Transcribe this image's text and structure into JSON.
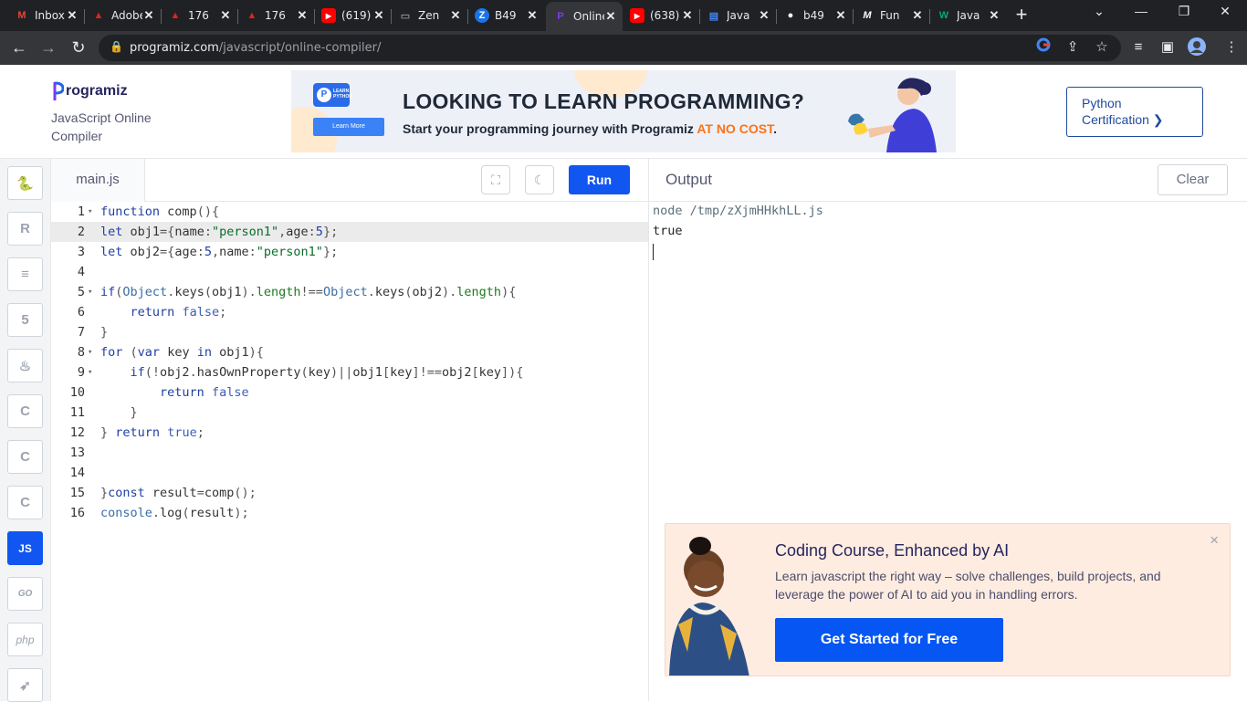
{
  "browser": {
    "tabs": [
      {
        "title": "Inbox",
        "icon": "gmail-icon",
        "color": "#ea4335"
      },
      {
        "title": "Adobe",
        "icon": "adobe-icon",
        "color": "#e2231a"
      },
      {
        "title": "176",
        "icon": "adobe-icon",
        "color": "#e2231a"
      },
      {
        "title": "176",
        "icon": "adobe-icon",
        "color": "#e2231a"
      },
      {
        "title": "(619)",
        "icon": "youtube-icon",
        "color": "#ff0000"
      },
      {
        "title": "Zen",
        "icon": "zen-icon",
        "color": "#888888"
      },
      {
        "title": "B49",
        "icon": "zoho-icon",
        "color": "#1a73e8"
      },
      {
        "title": "Online",
        "icon": "programiz-icon",
        "color": "#7c3aed"
      },
      {
        "title": "(638)",
        "icon": "youtube-icon",
        "color": "#ff0000"
      },
      {
        "title": "Java",
        "icon": "docs-icon",
        "color": "#4285f4"
      },
      {
        "title": "b49",
        "icon": "github-icon",
        "color": "#ffffff"
      },
      {
        "title": "Fun",
        "icon": "medium-icon",
        "color": "#ffffff"
      },
      {
        "title": "Java",
        "icon": "w3-icon",
        "color": "#04aa6d"
      }
    ],
    "active_tab_index": 7,
    "url_host": "programiz.com",
    "url_path": "/javascript/online-compiler/"
  },
  "header": {
    "logo_text": "rogramiz",
    "subtitle": "JavaScript Online Compiler",
    "cert_button": "Python Certification ❯"
  },
  "banner": {
    "badge_line1": "LEARN",
    "badge_line2": "PYTHON",
    "badge_button": "Learn More",
    "headline": "LOOKING TO LEARN PROGRAMMING?",
    "line_prefix": "Start your programming journey with Programiz ",
    "line_highlight": "AT NO COST",
    "line_suffix": "."
  },
  "languages": [
    {
      "name": "python",
      "icon": "python-icon",
      "label": "🐍"
    },
    {
      "name": "r",
      "icon": "r-icon",
      "label": "R"
    },
    {
      "name": "sql",
      "icon": "database-icon",
      "label": "≡"
    },
    {
      "name": "html",
      "icon": "html5-icon",
      "label": "5"
    },
    {
      "name": "java",
      "icon": "java-icon",
      "label": "♨"
    },
    {
      "name": "c",
      "icon": "c-icon",
      "label": "C"
    },
    {
      "name": "cpp",
      "icon": "cpp-icon",
      "label": "C"
    },
    {
      "name": "csharp",
      "icon": "csharp-icon",
      "label": "C"
    },
    {
      "name": "js",
      "icon": "js-icon",
      "label": "JS"
    },
    {
      "name": "go",
      "icon": "go-icon",
      "label": "GO"
    },
    {
      "name": "php",
      "icon": "php-icon",
      "label": "php"
    },
    {
      "name": "swift",
      "icon": "swift-icon",
      "label": "➶"
    }
  ],
  "editor": {
    "file_name": "main.js",
    "run_label": "Run",
    "active_line": 2,
    "lines": [
      "function comp(){",
      "let obj1={name:\"person1\",age:5};",
      "let obj2={age:5,name:\"person1\"};",
      "",
      "if(Object.keys(obj1).length!==Object.keys(obj2).length){",
      "    return false;",
      "}",
      "for (var key in obj1){",
      "    if(!obj2.hasOwnProperty(key)||obj1[key]!==obj2[key]){",
      "        return false",
      "    }",
      "} return true;",
      "",
      "",
      "}const result=comp();",
      "console.log(result);"
    ],
    "fold_lines": [
      1,
      5,
      8,
      9
    ]
  },
  "output": {
    "title": "Output",
    "clear_label": "Clear",
    "command": "node /tmp/zXjmHHkhLL.js",
    "result": "true"
  },
  "promo": {
    "title": "Coding Course, Enhanced by AI",
    "description": "Learn javascript the right way – solve challenges, build projects, and leverage the power of AI to aid you in handling errors.",
    "button": "Get Started for Free",
    "close": "×"
  }
}
